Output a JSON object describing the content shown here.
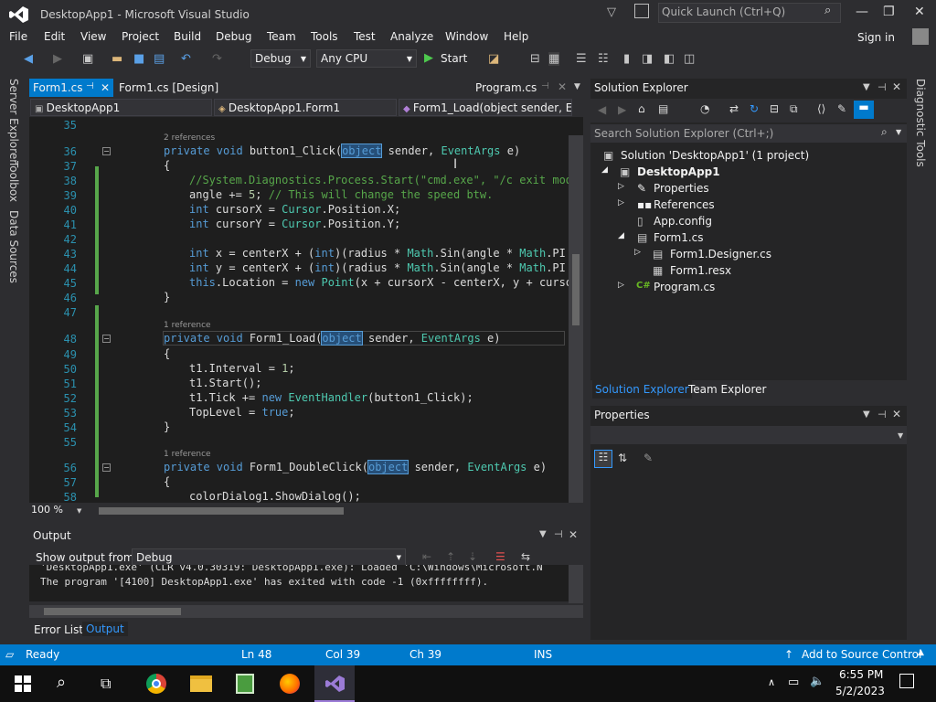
{
  "window": {
    "title": "DesktopApp1 - Microsoft Visual Studio",
    "quick_launch": "Quick Launch (Ctrl+Q)",
    "sign_in": "Sign in"
  },
  "menu": [
    "File",
    "Edit",
    "View",
    "Project",
    "Build",
    "Debug",
    "Team",
    "Tools",
    "Test",
    "Analyze",
    "Window",
    "Help"
  ],
  "toolbar": {
    "config": "Debug",
    "platform": "Any CPU",
    "start": "Start"
  },
  "left_tabs": [
    "Server Explorer",
    "Toolbox",
    "Data Sources"
  ],
  "editor_tabs": [
    {
      "label": "Form1.cs",
      "active": true
    },
    {
      "label": "Form1.cs [Design]"
    },
    {
      "label": "Program.cs"
    }
  ],
  "nav": {
    "project": "DesktopApp1",
    "class": "DesktopApp1.Form1",
    "member": "Form1_Load(object sender, Eve"
  },
  "code_lines": [
    {
      "n": "35",
      "t": ""
    },
    {
      "n": "36",
      "t": "private void button1_Click(object sender, EventArgs e)",
      "ref": "2 references"
    },
    {
      "n": "37",
      "t": "{"
    },
    {
      "n": "38",
      "t": "//System.Diagnostics.Process.Start(\"cmd.exe\", \"/c exit mode"
    },
    {
      "n": "39",
      "t": "angle += 5; // This will change the speed btw."
    },
    {
      "n": "40",
      "t": "int cursorX = Cursor.Position.X;"
    },
    {
      "n": "41",
      "t": "int cursorY = Cursor.Position.Y;"
    },
    {
      "n": "42",
      "t": ""
    },
    {
      "n": "43",
      "t": "int x = centerX + (int)(radius * Math.Sin(angle * Math.PI /"
    },
    {
      "n": "44",
      "t": "int y = centerX + (int)(radius * Math.Sin(angle * Math.PI /"
    },
    {
      "n": "45",
      "t": "this.Location = new Point(x + cursorX - centerX, y + cursor"
    },
    {
      "n": "46",
      "t": "}"
    },
    {
      "n": "47",
      "t": ""
    },
    {
      "n": "48",
      "t": "private void Form1_Load(object sender, EventArgs e)",
      "ref": "1 reference"
    },
    {
      "n": "49",
      "t": "{"
    },
    {
      "n": "50",
      "t": "t1.Interval = 1;"
    },
    {
      "n": "51",
      "t": "t1.Start();"
    },
    {
      "n": "52",
      "t": "t1.Tick += new EventHandler(button1_Click);"
    },
    {
      "n": "53",
      "t": "TopLevel = true;"
    },
    {
      "n": "54",
      "t": "}"
    },
    {
      "n": "55",
      "t": ""
    },
    {
      "n": "56",
      "t": "private void Form1_DoubleClick(object sender, EventArgs e)",
      "ref": "1 reference"
    },
    {
      "n": "57",
      "t": "{"
    },
    {
      "n": "58",
      "t": "colorDialog1.ShowDialog();"
    }
  ],
  "zoom": "100 %",
  "output": {
    "title": "Output",
    "show_from_label": "Show output from:",
    "source": "Debug",
    "line1": "'DesktopApp1.exe' (CLR v4.0.30319: DesktopApp1.exe): Loaded 'C:\\Windows\\Microsoft.N",
    "line2": "The program '[4100] DesktopApp1.exe' has exited with code -1 (0xffffffff)."
  },
  "bottom_tabs": [
    "Error List",
    "Output"
  ],
  "solution_explorer": {
    "title": "Solution Explorer",
    "search": "Search Solution Explorer (Ctrl+;)",
    "items": [
      "Solution 'DesktopApp1' (1 project)",
      "DesktopApp1",
      "Properties",
      "References",
      "App.config",
      "Form1.cs",
      "Form1.Designer.cs",
      "Form1.resx",
      "Program.cs"
    ],
    "tabs": [
      "Solution Explorer",
      "Team Explorer"
    ]
  },
  "properties": {
    "title": "Properties"
  },
  "right_tab": "Diagnostic Tools",
  "status": {
    "ready": "Ready",
    "ln": "Ln 48",
    "col": "Col 39",
    "ch": "Ch 39",
    "ins": "INS",
    "source_control": "Add to Source Control"
  },
  "taskbar": {
    "time": "6:55 PM",
    "date": "5/2/2023"
  }
}
